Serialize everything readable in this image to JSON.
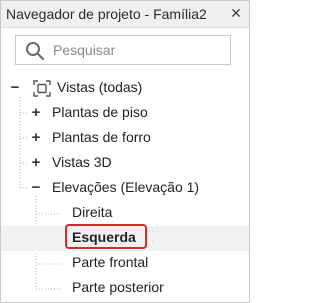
{
  "window": {
    "title": "Navegador de projeto - Família2",
    "close_glyph": "✕"
  },
  "search": {
    "placeholder": "Pesquisar",
    "value": "",
    "icon": "search-icon"
  },
  "tree": {
    "root": {
      "label": "Vistas (todas)",
      "toggle": "−",
      "icon": "views-icon",
      "children": [
        {
          "label": "Plantas de piso",
          "toggle": "+"
        },
        {
          "label": "Plantas de forro",
          "toggle": "+"
        },
        {
          "label": "Vistas 3D",
          "toggle": "+"
        },
        {
          "label": "Elevações (Elevação 1)",
          "toggle": "−",
          "children": [
            {
              "label": "Direita"
            },
            {
              "label": "Esquerda",
              "selected": true
            },
            {
              "label": "Parte frontal"
            },
            {
              "label": "Parte posterior"
            }
          ]
        }
      ]
    }
  },
  "colors": {
    "highlight": "#d42a2a",
    "selected_row": "#f1f1f1",
    "titlebar": "#f0f0f0"
  }
}
